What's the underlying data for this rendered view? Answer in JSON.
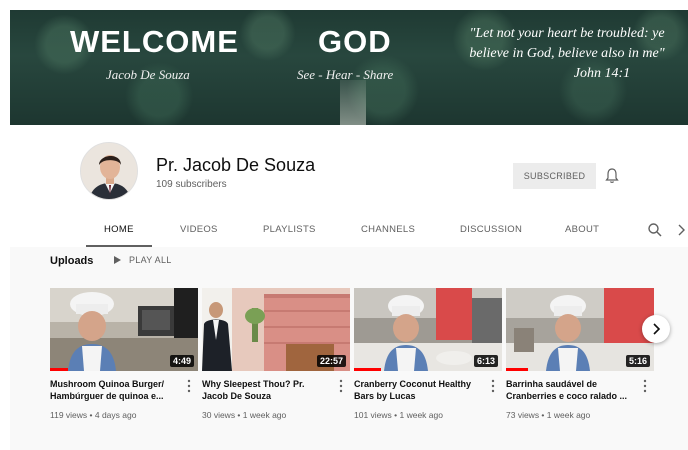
{
  "banner": {
    "welcome": "WELCOME",
    "name": "Jacob De Souza",
    "god": "GOD",
    "tagline": "See - Hear - Share",
    "quote_line1": "\"Let not your heart be troubled: ye",
    "quote_line2": "believe in God, believe also in me\"",
    "quote_ref": "John 14:1"
  },
  "channel": {
    "title": "Pr. Jacob De Souza",
    "subscribers": "109 subscribers",
    "subscribe_label": "SUBSCRIBED"
  },
  "tabs": [
    {
      "label": "HOME",
      "active": true
    },
    {
      "label": "VIDEOS"
    },
    {
      "label": "PLAYLISTS"
    },
    {
      "label": "CHANNELS"
    },
    {
      "label": "DISCUSSION"
    },
    {
      "label": "ABOUT"
    }
  ],
  "uploads": {
    "title": "Uploads",
    "play_all": "PLAY ALL",
    "videos": [
      {
        "title": "Mushroom Quinoa Burger/ Hambúrguer de quinoa e...",
        "duration": "4:49",
        "meta": "119 views • 4 days ago",
        "progress": 0.12
      },
      {
        "title": "Why Sleepest Thou? Pr. Jacob De Souza",
        "duration": "22:57",
        "meta": "30 views • 1 week ago"
      },
      {
        "title": "Cranberry Coconut Healthy Bars by Lucas",
        "duration": "6:13",
        "meta": "101 views • 1 week ago",
        "progress": 0.18
      },
      {
        "title": "Barrinha saudável de Cranberries e coco ralado ...",
        "duration": "5:16",
        "meta": "73 views • 1 week ago",
        "progress": 0.15
      }
    ]
  },
  "colors": {
    "accent_red": "#ff0000",
    "text_primary": "#0f0f0f",
    "text_secondary": "#606060",
    "banner_green": "#28473e"
  },
  "icons": {
    "bell": "bell-icon",
    "search": "search-icon",
    "more": "chevron-right-icon",
    "play": "play-icon",
    "next": "chevron-right-icon",
    "kebab": "more-vertical-icon"
  }
}
